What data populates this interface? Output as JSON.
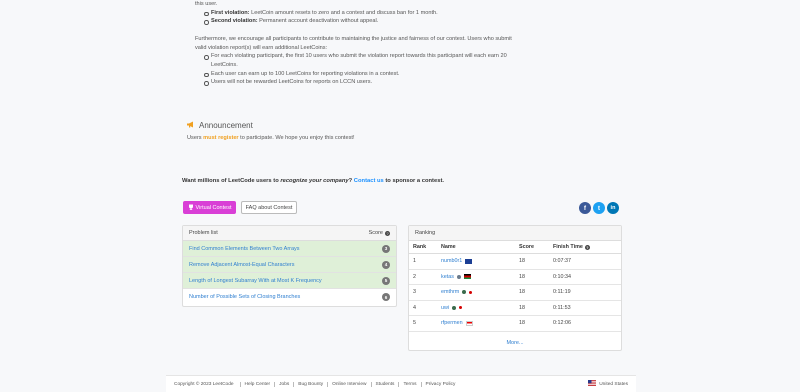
{
  "rules": {
    "top_line": "this user.",
    "violations": [
      {
        "label": "First violation:",
        "text": " LeetCoin amount resets to zero and a contest and discuss ban for 1 month."
      },
      {
        "label": "Second violation:",
        "text": " Permanent account deactivation without appeal."
      }
    ],
    "paragraph": "Furthermore, we encourage all participants to contribute to maintaining the justice and fairness of our contest. Users who submit valid violation report(s) will earn additional LeetCoins:",
    "rewards": [
      "For each violating participant, the first 10 users who submit the violation report towards this participant will each earn 20 LeetCoins.",
      "Each user can earn up to 100 LeetCoins for reporting violations in a contest.",
      "Users will not be rewarded LeetCoins for reports on LCCN users."
    ]
  },
  "announcement": {
    "icon": "megaphone-icon",
    "title": "Announcement",
    "pre": "Users ",
    "highlight": "must register",
    "post": " to participate. We hope you enjoy this contest!"
  },
  "sponsor": {
    "pre": "Want millions of LeetCode users to ",
    "italic": "recognize your company",
    "mid": "? ",
    "link": "Contact us",
    "post": " to sponsor a contest."
  },
  "buttons": {
    "virtual": "Virtual Contest",
    "faq": "FAQ about Contest"
  },
  "social": [
    {
      "icon": "facebook-icon",
      "glyph": "f",
      "color": "#3b5998"
    },
    {
      "icon": "twitter-icon",
      "glyph": "t",
      "color": "#1da1f2"
    },
    {
      "icon": "linkedin-icon",
      "glyph": "in",
      "color": "#0077b5"
    }
  ],
  "problems": {
    "header": "Problem list",
    "score_header": "Score",
    "items": [
      {
        "title": "Find Common Elements Between Two Arrays",
        "score": "3",
        "solved": true
      },
      {
        "title": "Remove Adjacent Almost-Equal Characters",
        "score": "4",
        "solved": true
      },
      {
        "title": "Length of Longest Subarray With at Most K Frequency",
        "score": "5",
        "solved": true
      },
      {
        "title": "Number of Possible Sets of Closing Branches",
        "score": "6",
        "solved": false
      }
    ]
  },
  "ranking": {
    "header": "Ranking",
    "columns": {
      "rank": "Rank",
      "name": "Name",
      "score": "Score",
      "time": "Finish Time"
    },
    "rows": [
      {
        "rank": "1",
        "name": "numb0r1",
        "score": "18",
        "time": "0:07:37"
      },
      {
        "rank": "2",
        "name": "ketas",
        "score": "18",
        "time": "0:10:34"
      },
      {
        "rank": "3",
        "name": "emthrm",
        "score": "18",
        "time": "0:11:19"
      },
      {
        "rank": "4",
        "name": "uwi",
        "score": "18",
        "time": "0:11:53"
      },
      {
        "rank": "5",
        "name": "rfpermen",
        "score": "18",
        "time": "0:12:06"
      }
    ],
    "more": "More..."
  },
  "footer": {
    "copyright": "Copyright © 2023 LeetCode",
    "links": [
      "Help Center",
      "Jobs",
      "Bug Bounty",
      "Online Interview",
      "Students",
      "Terms",
      "Privacy Policy"
    ],
    "region": "United States"
  }
}
